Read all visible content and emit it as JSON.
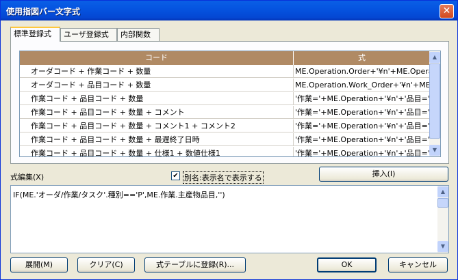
{
  "window": {
    "title": "使用指図バー文字式",
    "close_glyph": "✕"
  },
  "tabs": [
    "標準登録式",
    "ユーザ登録式",
    "内部関数"
  ],
  "grid": {
    "columns": [
      "コード",
      "式"
    ],
    "rows": [
      [
        "オーダコード + 作業コード + 数量",
        "ME.Operation.Order+'¥n'+ME.Operation."
      ],
      [
        "オーダコード + 品目コード + 数量",
        "ME.Operation.Work_Order+'¥n'+ME.Ope"
      ],
      [
        "作業コード + 品目コード + 数量",
        "'作業='+ME.Operation+'¥n'+'品目='+ME."
      ],
      [
        "作業コード + 品目コード + 数量 + コメント",
        "'作業='+ME.Operation+'¥n'+'品目='+ME."
      ],
      [
        "作業コード + 品目コード + 数量 + コメント1 + コメント2",
        "'作業='+ME.Operation+'¥n'+'品目='+ME."
      ],
      [
        "作業コード + 品目コード + 数量 + 最遅終了日時",
        "'作業='+ME.Operation+'¥n'+'品目='+ME."
      ],
      [
        "作業コード + 品目コード + 数量 + 仕様1 + 数値仕様1",
        "'作業='+ME.Operation+'¥n'+'品目='+ME."
      ]
    ]
  },
  "form": {
    "edit_label": "式編集(X)",
    "alias_checkbox_label": "別名:表示名で表示する",
    "alias_checked": true,
    "insert_button": "挿入(I)"
  },
  "editor": {
    "value": "IF(ME.'オーダ/作業/タスク'.種別=='P',ME.作業.主産物品目,'')"
  },
  "buttons": {
    "expand": "展開(M)",
    "clear": "クリア(C)",
    "register": "式テーブルに登録(R)...",
    "ok": "OK",
    "cancel": "キャンセル"
  }
}
